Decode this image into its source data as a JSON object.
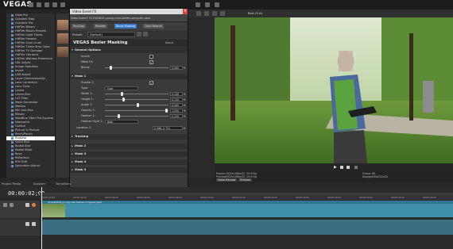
{
  "app": {
    "logo": "VEGAS"
  },
  "fx_list": {
    "items": [
      {
        "label": "Glow Pro"
      },
      {
        "label": "Gradient Map"
      },
      {
        "label": "Gradient Pro"
      },
      {
        "label": "HitFilm Bloom"
      },
      {
        "label": "HitFilm Bloom Presets"
      },
      {
        "label": "HitFilm Light Flares"
      },
      {
        "label": "HitFilm Presets"
      },
      {
        "label": "HitFilm Scan Lines"
      },
      {
        "label": "HitFilm Three Strip Color"
      },
      {
        "label": "HitFilm TV Damage"
      },
      {
        "label": "HitFilm Vibrance"
      },
      {
        "label": "HitFilm Witness Protection"
      },
      {
        "label": "HSL Adjust"
      },
      {
        "label": "Image Stabilizer"
      },
      {
        "label": "Invert"
      },
      {
        "label": "LAB Adjust"
      },
      {
        "label": "Layer Dimensionality"
      },
      {
        "label": "Lens Correction"
      },
      {
        "label": "Lens Flare"
      },
      {
        "label": "Levels"
      },
      {
        "label": "Linear Blur"
      },
      {
        "label": "LUT Filter"
      },
      {
        "label": "Mask Generator"
      },
      {
        "label": "Median"
      },
      {
        "label": "Min and Max"
      },
      {
        "label": "Mosaic"
      },
      {
        "label": "NewBlue Titler Pro Express"
      },
      {
        "label": "Newsprint"
      },
      {
        "label": "Outline"
      },
      {
        "label": "Picture In Picture"
      },
      {
        "label": "Pinch/Punch"
      },
      {
        "label": "Pixelate"
      },
      {
        "label": "Quick Blur"
      },
      {
        "label": "Radial Blur"
      },
      {
        "label": "Radial Mask"
      },
      {
        "label": "Rays"
      },
      {
        "label": "Reflection"
      },
      {
        "label": "Rift Shift"
      },
      {
        "label": "Saturation Adjust"
      }
    ],
    "selected_index": 31
  },
  "dialog": {
    "title": "Video Event FX",
    "chain_label": "Video Event FX:",
    "chain_path": "311924819-young-man-tablet-computer-park",
    "chips": [
      "Pan/Crop",
      "Mediate",
      "Bezier Masking",
      "Color Balance"
    ],
    "preset_label": "Preset:",
    "preset_value": "(Default)",
    "plugin_name": "VEGAS Bezier Masking",
    "about_label": "About",
    "sections": {
      "general": "General Options",
      "mask1": "Mask 1",
      "tracking": "Tracking",
      "mask2": "Mask 2",
      "mask3": "Mask 3",
      "mask4": "Mask 4",
      "mask5": "Mask 5"
    },
    "general_params": {
      "invert_label": "Invert:",
      "mask_fx_label": "Mask FX:",
      "blend_label": "Blend:",
      "blend_value": "0.000"
    },
    "mask1_params": {
      "enable_label": "Enable 1:",
      "type_label": "Type:",
      "type_value": "Oval",
      "width_label": "Width 1:",
      "width_value": "0.106",
      "height_label": "Height 1:",
      "height_value": "0.120",
      "angle_label": "Angle 1:",
      "angle_value": "0.000",
      "opacity_label": "Opacity 1:",
      "opacity_value": "1.000",
      "feather_label": "Feather 1:",
      "feather_value": "0.220",
      "feather_style_label": "Feather Style 1:",
      "feather_style_value": "Both",
      "location_label": "Location 1:",
      "location_value": "0.366, 0.721"
    }
  },
  "preview": {
    "quality": "Best (Full)",
    "info": {
      "project_label": "Project:",
      "project_value": "1920x1080x32, 29.970p",
      "preview_label": "Preview:",
      "preview_value": "1920x1080x32, 29.970p",
      "display_label": "Display:",
      "display_value": "554x312x32",
      "frame_label": "Frame:",
      "frame_value": "60",
      "buttons": [
        "Video Preview",
        "Trimmer"
      ]
    }
  },
  "timeline": {
    "tabs": [
      "Project Media",
      "Explorer",
      "Transitions"
    ],
    "timecode": "00:00:02;00",
    "ruler_marks": [
      "00:00:00;00",
      "00:00:02;00",
      "00:00:04;00",
      "00:00:06;00",
      "00:00:08;00",
      "00:00:10;00",
      "00:00:12;00",
      "00:00:14;00",
      "00:00:16;00",
      "00:00:18;00",
      "00:00:20;00",
      "00:00:22;00",
      "00:00:24;00"
    ],
    "clip_label": "311924819-young-man-tablet-computer-park"
  }
}
